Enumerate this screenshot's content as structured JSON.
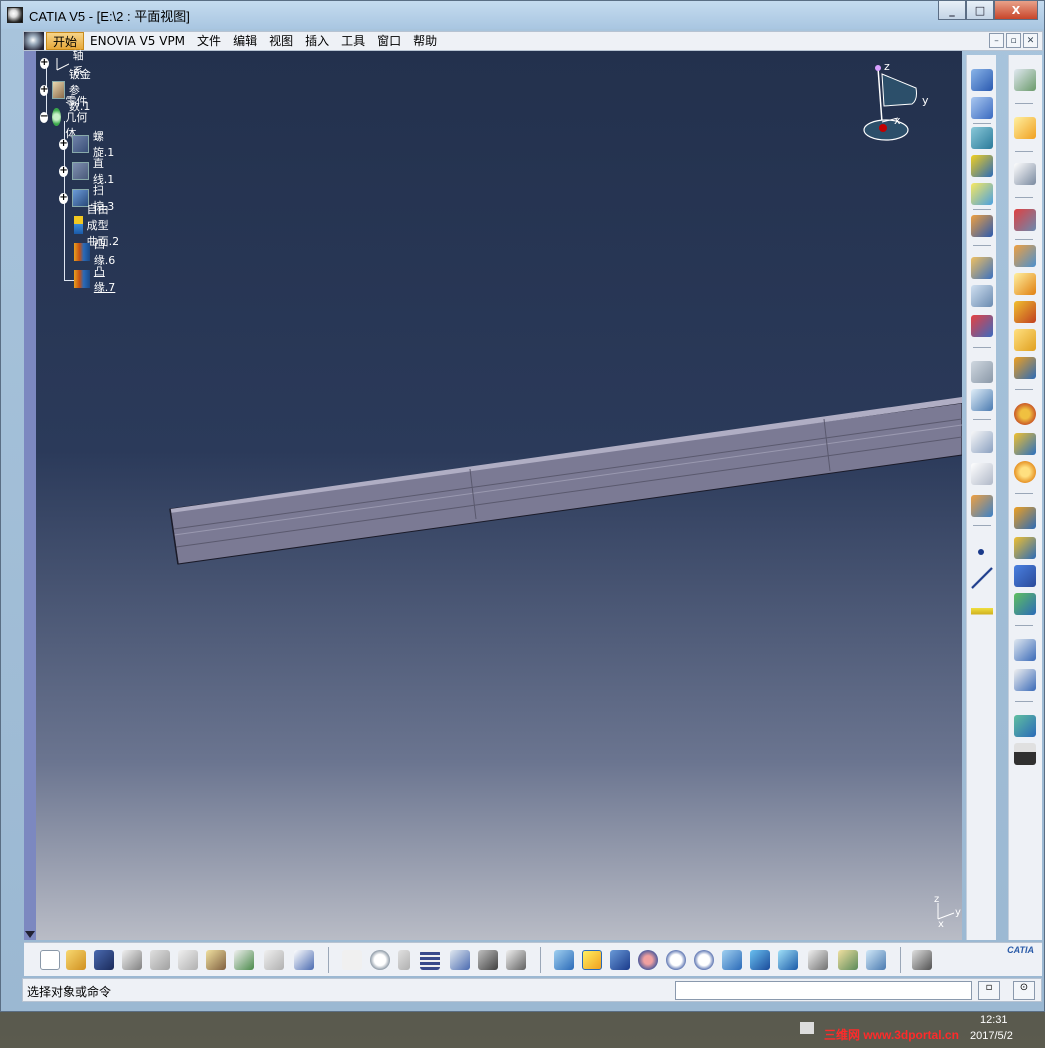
{
  "window": {
    "title": "CATIA V5 - [E:\\2 : 平面视图]",
    "controls": [
      "_",
      "□",
      "X"
    ]
  },
  "menubar": {
    "items": [
      "开始",
      "ENOVIA V5 VPM",
      "文件",
      "编辑",
      "视图",
      "插入",
      "工具",
      "窗口",
      "帮助"
    ]
  },
  "tree": {
    "nodes": [
      {
        "label": "轴系",
        "icon": "axis-system-icon"
      },
      {
        "label": "钣金参数.1",
        "icon": "sheetmetal-params-icon"
      },
      {
        "label": "零件几何体",
        "icon": "part-body-icon"
      },
      {
        "label": "螺旋.1",
        "icon": "helix-icon"
      },
      {
        "label": "直线.1",
        "icon": "line-icon"
      },
      {
        "label": "扫掠.3",
        "icon": "sweep-icon"
      },
      {
        "label": "自由成型曲面.2",
        "icon": "swept-wall-icon"
      },
      {
        "label": "凸缘.6",
        "icon": "flange-icon"
      },
      {
        "label": "凸缘.7",
        "icon": "flange-icon"
      }
    ]
  },
  "compass": {
    "z": "z",
    "y": "y",
    "x": "x"
  },
  "corner_axes": {
    "z": "z",
    "y": "y",
    "x": "x"
  },
  "statusbar": {
    "prompt": "选择对象或命令",
    "command_value": ""
  },
  "taskbar": {
    "time": "12:31",
    "date": "2017/5/2",
    "watermark": "三维网 www.3dportal.cn"
  },
  "brand": {
    "logo_text": "CATIA"
  }
}
